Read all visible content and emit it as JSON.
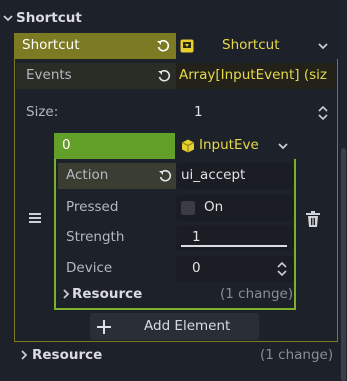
{
  "top_section": {
    "label": "Shortcut",
    "icon": "chevron-down-icon"
  },
  "shortcut_row": {
    "label": "Shortcut",
    "revert_icon": "revert-icon",
    "resource_icon": "shortcut-resource-icon",
    "value": "Shortcut",
    "dropdown_icon": "chevron-down-icon",
    "accent": "#c9bf2e",
    "label_bg": "#7c7a22"
  },
  "events_row": {
    "label": "Events",
    "revert_icon": "revert-icon",
    "value": "Array[InputEvent] (siz",
    "accent": "#c9bf2e"
  },
  "size_row": {
    "label": "Size:",
    "value": "1",
    "spinner_icon": "updown-icon"
  },
  "element": {
    "index": "0",
    "type_icon": "cube-icon",
    "type_value": "InputEve",
    "dropdown_icon": "chevron-down-icon",
    "drag_icon": "drag-handle-icon",
    "delete_icon": "trash-icon",
    "accent": "#7fb02a",
    "index_bg": "#63a02a",
    "properties": {
      "action": {
        "label": "Action",
        "value": "ui_accept",
        "revert_icon": "revert-icon"
      },
      "pressed": {
        "label": "Pressed",
        "value": "On",
        "checked": false
      },
      "strength": {
        "label": "Strength",
        "value": "1",
        "fraction": 1.0
      },
      "device": {
        "label": "Device",
        "value": "0",
        "spinner_icon": "updown-icon"
      }
    },
    "resource": {
      "label": "Resource",
      "changes": "(1 change)",
      "icon": "chevron-right-icon"
    }
  },
  "add_button": {
    "label": "Add Element",
    "icon": "plus-icon"
  },
  "bottom_section": {
    "label": "Resource",
    "changes": "(1 change)",
    "icon": "chevron-right-icon"
  }
}
